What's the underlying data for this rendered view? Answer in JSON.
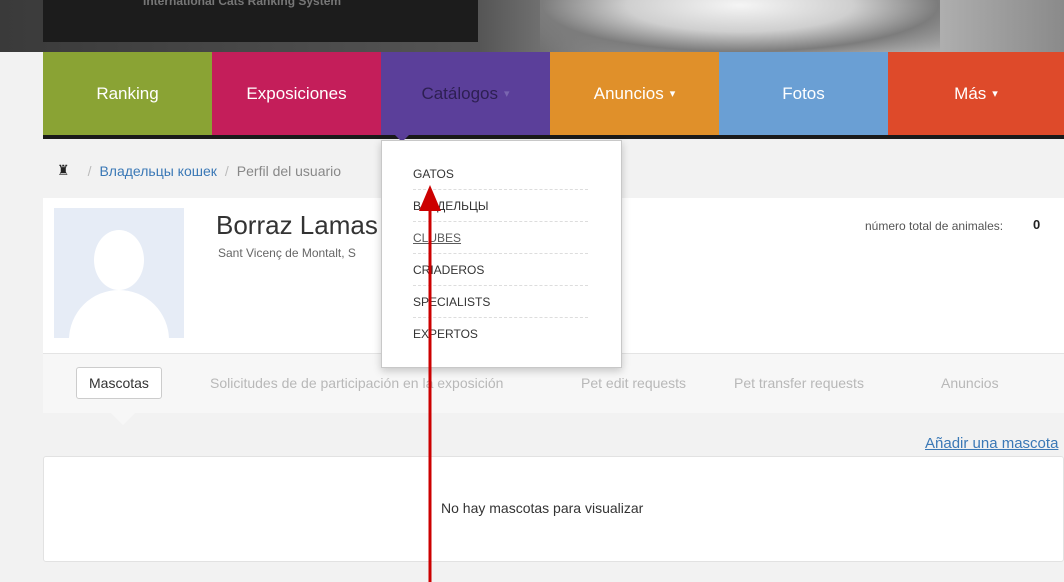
{
  "header": {
    "banner_text": "International Cats Ranking System"
  },
  "nav": {
    "items": [
      {
        "label": "Ranking",
        "color": "#8aa334",
        "caret": ""
      },
      {
        "label": "Exposiciones",
        "color": "#c41e5a",
        "caret": ""
      },
      {
        "label": "Catálogos",
        "color": "#5b3f9a",
        "caret": "▾",
        "text_color": "#2d1f52"
      },
      {
        "label": "Anuncios",
        "color": "#e0902a",
        "caret": "▾"
      },
      {
        "label": "Fotos",
        "color": "#6a9fd4",
        "caret": ""
      },
      {
        "label": "Más",
        "color": "#de4a2a",
        "caret": "▾"
      }
    ]
  },
  "breadcrumb": {
    "link": "Владельцы кошек",
    "current": "Perfil del usuario"
  },
  "profile": {
    "name": "Borraz Lamas",
    "location": "Sant Vicenç de Montalt, S",
    "total_label": "número total de animales:",
    "total_value": "0"
  },
  "tabs": [
    "Mascotas",
    "Solicitudes de de participación en la exposición",
    "Pet edit requests",
    "Pet transfer requests",
    "Anuncios"
  ],
  "add_pet": "Añadir una mascota",
  "empty_message": "No hay mascotas para visualizar",
  "dropdown": [
    "GATOS",
    "ВЛАДЕЛЬЦЫ",
    "CLUBES",
    "CRIADEROS",
    "SPECIALISTS",
    "EXPERTOS"
  ],
  "colors": {
    "annotation": "#cc0000",
    "link": "#3a78b6"
  }
}
